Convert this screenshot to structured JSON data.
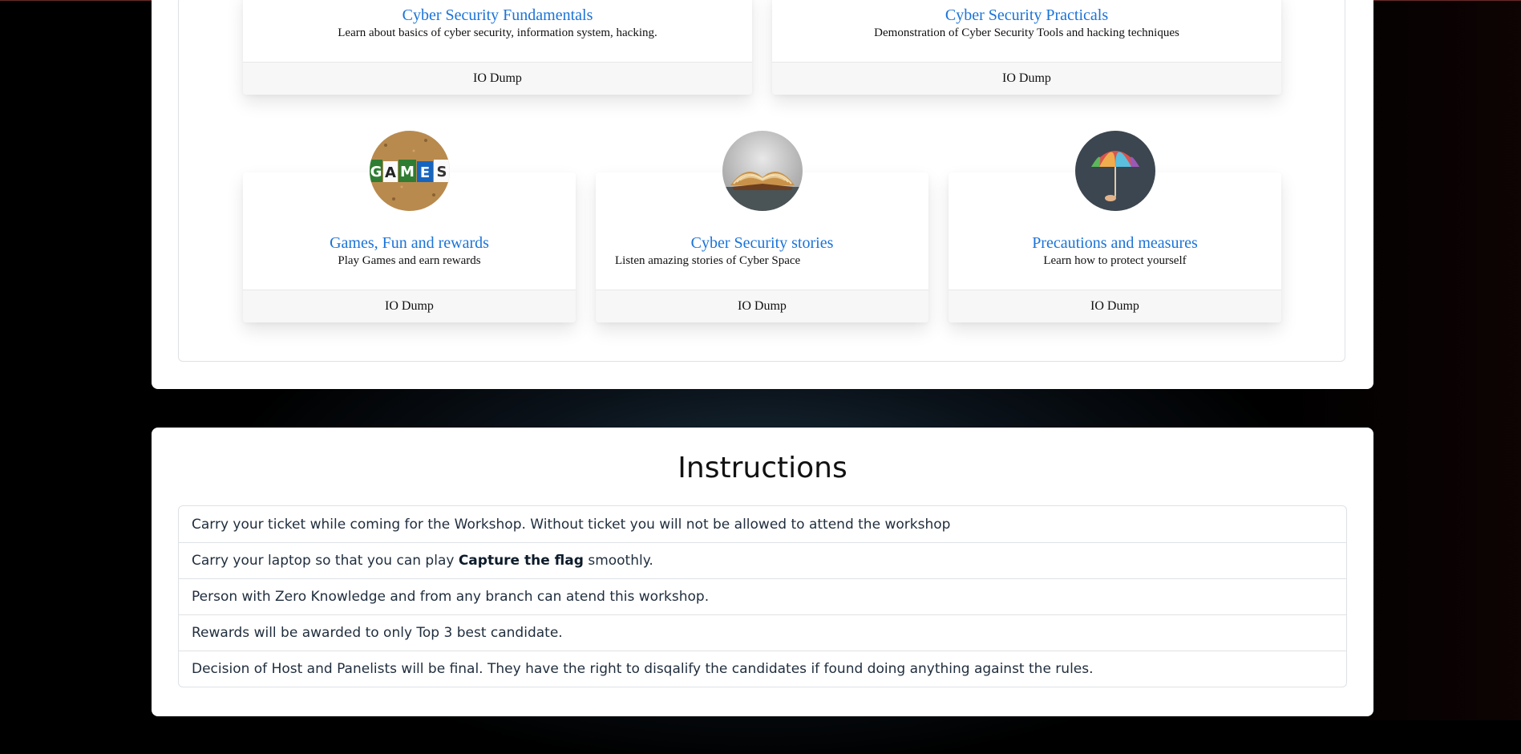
{
  "courses_top": [
    {
      "title": "Cyber Security Fundamentals",
      "description": "Learn about basics of cyber security, information system, hacking.",
      "footer": "IO Dump"
    },
    {
      "title": "Cyber Security Practicals",
      "description": "Demonstration of Cyber Security Tools and hacking techniques",
      "footer": "IO Dump"
    }
  ],
  "courses_bottom": [
    {
      "title": "Games, Fun and rewards",
      "description": "Play Games and earn rewards",
      "footer": "IO Dump",
      "image": "games-letters-image"
    },
    {
      "title": "Cyber Security stories",
      "description": "Listen amazing stories of Cyber Space",
      "footer": "IO Dump",
      "image": "open-book-image"
    },
    {
      "title": "Precautions and measures",
      "description": "Learn how to protect yourself",
      "footer": "IO Dump",
      "image": "umbrella-image"
    }
  ],
  "instructions": {
    "title": "Instructions",
    "items": [
      {
        "text": "Carry your ticket while coming for the Workshop. Without ticket you will not be allowed to attend the workshop"
      },
      {
        "before": "Carry your laptop so that you can play ",
        "bold": "Capture the flag",
        "after": " smoothly."
      },
      {
        "text": "Person with Zero Knowledge and from any branch can atend this workshop."
      },
      {
        "text": "Rewards will be awarded to only Top 3 best candidate."
      },
      {
        "text": "Decision of Host and Panelists will be final. They have the right to disqalify the candidates if found doing anything against the rules."
      }
    ]
  },
  "colors": {
    "link": "#1a73d8",
    "background": "#000000",
    "panel": "#ffffff"
  }
}
